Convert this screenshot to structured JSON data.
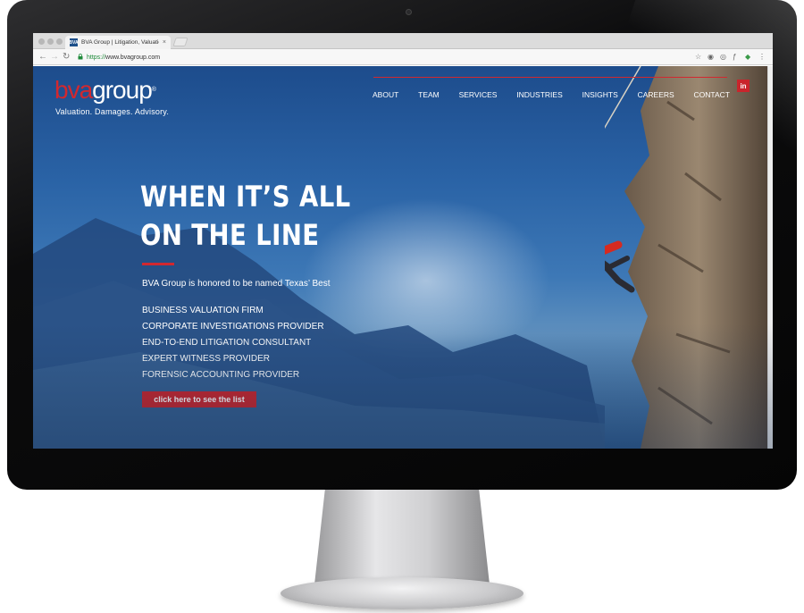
{
  "browser": {
    "tab_title": "BVA Group | Litigation, Valuatio",
    "tab_close": "×",
    "favicon_text": "BVA",
    "url_protocol": "https://",
    "url_host": "www.bvagroup.com",
    "nav_back": "←",
    "nav_forward": "→",
    "nav_reload": "↻",
    "toolbar_icons": [
      "star-icon",
      "extension-icon",
      "extension-icon",
      "extension-icon",
      "extension-icon",
      "menu-icon"
    ]
  },
  "site": {
    "logo_bva": "bva",
    "logo_group": "group",
    "tagline": "Valuation. Damages. Advisory.",
    "nav": [
      "ABOUT",
      "TEAM",
      "SERVICES",
      "INDUSTRIES",
      "INSIGHTS",
      "CAREERS",
      "CONTACT"
    ],
    "linkedin": "in",
    "brand_red": "#d2282f"
  },
  "hero": {
    "headline_line1": "WHEN IT’S ALL",
    "headline_line2": "ON THE LINE",
    "honored": "BVA Group is honored to be named Texas’ Best",
    "awards": [
      "BUSINESS VALUATION FIRM",
      "CORPORATE INVESTIGATIONS PROVIDER",
      "END-TO-END LITIGATION CONSULTANT",
      "EXPERT WITNESS PROVIDER",
      "FORENSIC ACCOUNTING PROVIDER"
    ],
    "cta": "click here to see the list"
  }
}
